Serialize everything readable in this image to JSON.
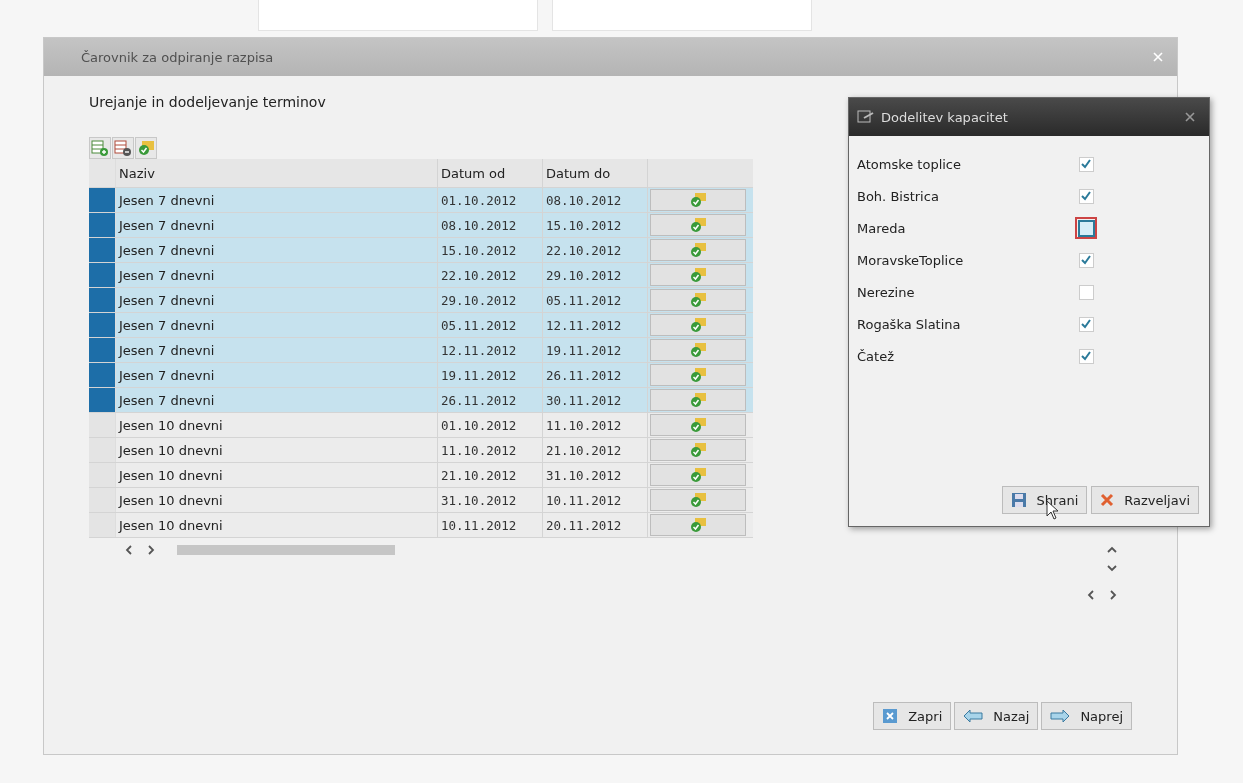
{
  "window": {
    "title": "Čarovnik za odpiranje razpisa"
  },
  "heading": "Urejanje in dodeljevanje terminov",
  "table": {
    "columns": [
      "Naziv",
      "Datum od",
      "Datum do"
    ],
    "rows": [
      {
        "name": "Jesen 7 dnevni",
        "from": "01.10.2012",
        "to": "08.10.2012",
        "selected": true
      },
      {
        "name": "Jesen 7 dnevni",
        "from": "08.10.2012",
        "to": "15.10.2012",
        "selected": true
      },
      {
        "name": "Jesen 7 dnevni",
        "from": "15.10.2012",
        "to": "22.10.2012",
        "selected": true
      },
      {
        "name": "Jesen 7 dnevni",
        "from": "22.10.2012",
        "to": "29.10.2012",
        "selected": true
      },
      {
        "name": "Jesen 7 dnevni",
        "from": "29.10.2012",
        "to": "05.11.2012",
        "selected": true
      },
      {
        "name": "Jesen 7 dnevni",
        "from": "05.11.2012",
        "to": "12.11.2012",
        "selected": true
      },
      {
        "name": "Jesen 7 dnevni",
        "from": "12.11.2012",
        "to": "19.11.2012",
        "selected": true
      },
      {
        "name": "Jesen 7 dnevni",
        "from": "19.11.2012",
        "to": "26.11.2012",
        "selected": true
      },
      {
        "name": "Jesen 7 dnevni",
        "from": "26.11.2012",
        "to": "30.11.2012",
        "selected": true
      },
      {
        "name": "Jesen 10 dnevni",
        "from": "01.10.2012",
        "to": "11.10.2012",
        "selected": false
      },
      {
        "name": "Jesen 10 dnevni",
        "from": "11.10.2012",
        "to": "21.10.2012",
        "selected": false
      },
      {
        "name": "Jesen 10 dnevni",
        "from": "21.10.2012",
        "to": "31.10.2012",
        "selected": false
      },
      {
        "name": "Jesen 10 dnevni",
        "from": "31.10.2012",
        "to": "10.11.2012",
        "selected": false
      },
      {
        "name": "Jesen 10 dnevni",
        "from": "10.11.2012",
        "to": "20.11.2012",
        "selected": false
      }
    ]
  },
  "dialog": {
    "title": "Dodelitev kapacitet",
    "items": [
      {
        "label": "Atomske toplice",
        "checked": true,
        "focused": false
      },
      {
        "label": "Boh. Bistrica",
        "checked": true,
        "focused": false
      },
      {
        "label": "Mareda",
        "checked": false,
        "focused": true
      },
      {
        "label": "MoravskeToplice",
        "checked": true,
        "focused": false
      },
      {
        "label": "Nerezine",
        "checked": false,
        "focused": false
      },
      {
        "label": "Rogaška Slatina",
        "checked": true,
        "focused": false
      },
      {
        "label": "Čatež",
        "checked": true,
        "focused": false
      }
    ],
    "buttons": [
      {
        "label": "Shrani",
        "kind": "save"
      },
      {
        "label": "Razveljavi",
        "kind": "undo"
      }
    ]
  },
  "buttons": [
    {
      "label": "Zapri",
      "kind": "close"
    },
    {
      "label": "Nazaj",
      "kind": "back"
    },
    {
      "label": "Naprej",
      "kind": "next"
    }
  ]
}
